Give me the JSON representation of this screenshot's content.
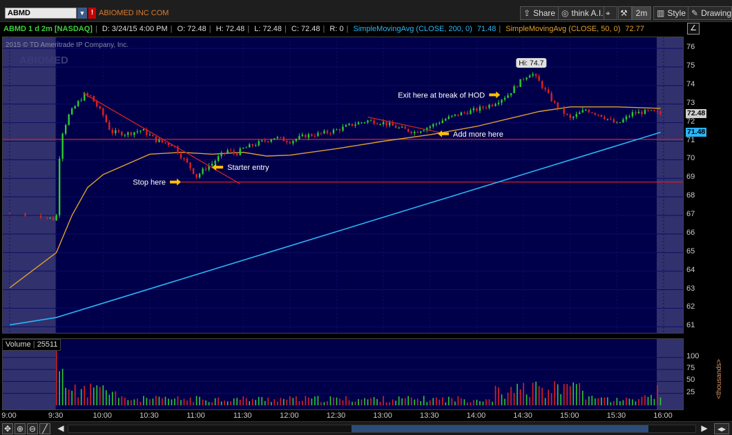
{
  "toolbar": {
    "symbol": "ABMD",
    "company": "ABIOMED INC COM",
    "share_label": "Share",
    "thinkai_label": "think A.I.",
    "timeframe_label": "2m",
    "style_label": "Style",
    "drawings_label": "Drawings"
  },
  "info": {
    "symbol_label": "ABMD 1 d 2m [NASDAQ]",
    "date": "D: 3/24/15 4:00 PM",
    "open": "O: 72.48",
    "high": "H: 72.48",
    "low": "L: 72.48",
    "close": "C: 72.48",
    "range": "R: 0",
    "sma200_label": "SimpleMovingAvg (CLOSE, 200, 0)",
    "sma200_value": "71.48",
    "sma50_label": "SimpleMovingAvg (CLOSE, 50, 0)",
    "sma50_value": "72.77"
  },
  "watermark": {
    "copyright": "2015 © TD Ameritrade IP Company, Inc.",
    "symbol_name": "ABIOMED"
  },
  "volume": {
    "label": "Volume",
    "value": "25511",
    "unit_label": "<thousands>"
  },
  "colors": {
    "plot_bg": "#00004a",
    "up": "#2ecc2e",
    "down": "#e02020",
    "sma50": "#e0a030",
    "sma200": "#29b6f6",
    "annotation": "#ffffff",
    "arrow": "#ffc000",
    "trendline": "#d02020"
  },
  "chart_data": {
    "type": "candlestick",
    "x_labels": [
      "9:00",
      "9:30",
      "10:00",
      "10:30",
      "11:00",
      "11:30",
      "12:00",
      "12:30",
      "13:00",
      "13:30",
      "14:00",
      "14:30",
      "15:00",
      "15:30",
      "16:00"
    ],
    "y_ticks": [
      61,
      62,
      63,
      64,
      65,
      66,
      67,
      68,
      69,
      70,
      71,
      72,
      73,
      74,
      75,
      76
    ],
    "ylim": [
      60.6,
      76.6
    ],
    "price_path": [
      [
        "9:00",
        67.1
      ],
      [
        "9:20",
        67.0
      ],
      [
        "9:28",
        66.8
      ],
      [
        "9:30",
        67.0
      ],
      [
        "9:31",
        69.5
      ],
      [
        "9:34",
        71.5
      ],
      [
        "9:38",
        72.4
      ],
      [
        "9:43",
        73.0
      ],
      [
        "9:48",
        73.5
      ],
      [
        "9:52",
        73.4
      ],
      [
        "10:00",
        72.4
      ],
      [
        "10:05",
        71.5
      ],
      [
        "10:15",
        71.4
      ],
      [
        "10:25",
        71.6
      ],
      [
        "10:35",
        71.0
      ],
      [
        "10:45",
        70.8
      ],
      [
        "10:50",
        70.2
      ],
      [
        "10:55",
        69.7
      ],
      [
        "11:00",
        69.1
      ],
      [
        "11:05",
        69.5
      ],
      [
        "11:10",
        69.8
      ],
      [
        "11:15",
        70.2
      ],
      [
        "11:20",
        70.5
      ],
      [
        "11:25",
        70.3
      ],
      [
        "11:30",
        70.6
      ],
      [
        "11:40",
        70.9
      ],
      [
        "11:50",
        71.2
      ],
      [
        "12:00",
        71.0
      ],
      [
        "12:10",
        71.3
      ],
      [
        "12:20",
        71.4
      ],
      [
        "12:30",
        71.6
      ],
      [
        "12:40",
        71.9
      ],
      [
        "12:50",
        72.1
      ],
      [
        "13:00",
        72.0
      ],
      [
        "13:10",
        71.7
      ],
      [
        "13:20",
        71.5
      ],
      [
        "13:30",
        71.8
      ],
      [
        "13:40",
        72.2
      ],
      [
        "13:50",
        72.5
      ],
      [
        "14:00",
        72.7
      ],
      [
        "14:10",
        73.0
      ],
      [
        "14:20",
        73.5
      ],
      [
        "14:30",
        74.4
      ],
      [
        "14:35",
        74.7
      ],
      [
        "14:40",
        74.2
      ],
      [
        "14:50",
        73.0
      ],
      [
        "15:00",
        72.2
      ],
      [
        "15:10",
        72.7
      ],
      [
        "15:20",
        72.4
      ],
      [
        "15:30",
        71.9
      ],
      [
        "15:40",
        72.5
      ],
      [
        "15:50",
        72.6
      ],
      [
        "15:58",
        72.48
      ]
    ],
    "sma50_path": [
      [
        "9:00",
        63.1
      ],
      [
        "9:30",
        65.0
      ],
      [
        "9:40",
        67.0
      ],
      [
        "9:50",
        68.5
      ],
      [
        "10:00",
        69.2
      ],
      [
        "10:30",
        70.3
      ],
      [
        "10:50",
        70.4
      ],
      [
        "11:10",
        70.3
      ],
      [
        "11:30",
        70.4
      ],
      [
        "11:45",
        70.2
      ],
      [
        "12:00",
        70.25
      ],
      [
        "12:30",
        70.6
      ],
      [
        "13:00",
        71.0
      ],
      [
        "13:30",
        71.35
      ],
      [
        "14:00",
        71.8
      ],
      [
        "14:20",
        72.2
      ],
      [
        "14:40",
        72.6
      ],
      [
        "15:00",
        72.85
      ],
      [
        "15:30",
        72.85
      ],
      [
        "15:58",
        72.77
      ]
    ],
    "sma200_path": [
      [
        "9:00",
        61.1
      ],
      [
        "9:30",
        61.5
      ],
      [
        "15:58",
        71.48
      ]
    ],
    "hod_label": "Hi: 74.7",
    "hod_value": 74.7,
    "lod_line": 68.8,
    "resistance_line": 71.1,
    "trendlines": [
      {
        "from": [
          "9:47",
          73.6
        ],
        "to": [
          "11:28",
          68.7
        ]
      },
      {
        "from": [
          "12:50",
          72.3
        ],
        "to": [
          "13:40",
          71.4
        ]
      }
    ],
    "annotations": [
      {
        "text": "Exit here at break of HOD",
        "at": [
          "14:15",
          73.5
        ],
        "side": "left"
      },
      {
        "text": "Add more here",
        "at": [
          "13:35",
          71.4
        ],
        "side": "right"
      },
      {
        "text": "Starter entry",
        "at": [
          "11:10",
          69.6
        ],
        "side": "right"
      },
      {
        "text": "Stop here",
        "at": [
          "10:50",
          68.8
        ],
        "side": "left"
      }
    ],
    "last_price": 72.48,
    "sma200_last": 71.48,
    "volume": {
      "ylim": [
        0,
        130
      ],
      "y_ticks": [
        25,
        50,
        75,
        100
      ],
      "unit": "thousands"
    }
  }
}
